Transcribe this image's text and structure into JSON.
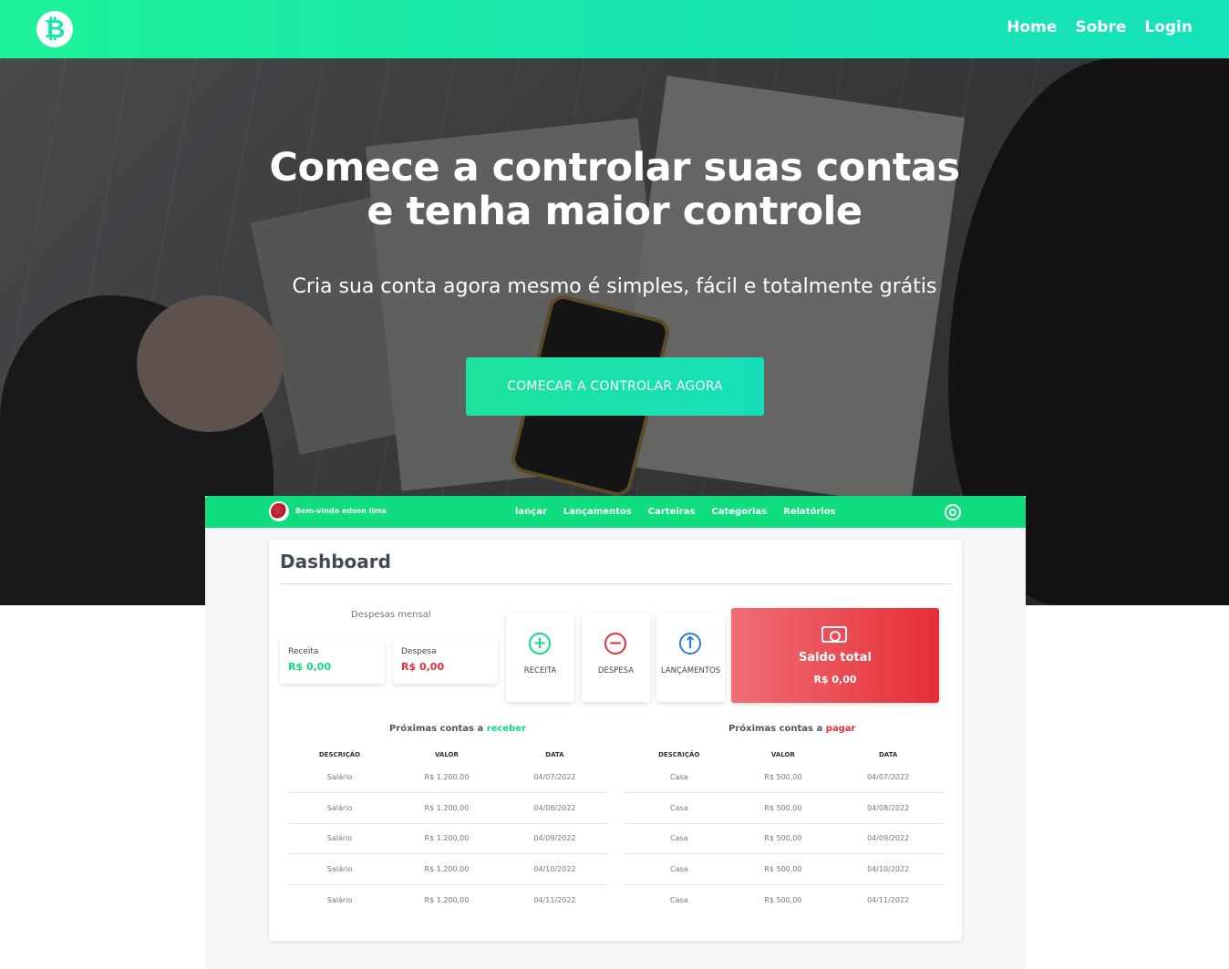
{
  "navbar": {
    "logo_glyph": "₿",
    "links": [
      "Home",
      "Sobre",
      "Login"
    ]
  },
  "hero": {
    "title_line1": "Comece a controlar suas contas",
    "title_line2": "e tenha maior controle",
    "subtitle": "Cria sua conta agora mesmo é simples, fácil e totalmente grátis",
    "cta_label": "COMECAR A CONTROLAR AGORA"
  },
  "preview": {
    "welcome": "Bem-vindo edson lima",
    "nav_links": [
      "lançar",
      "Lançamentos",
      "Carteiras",
      "Categorias",
      "Relatórios"
    ],
    "title": "Dashboard",
    "monthly_label": "Despesas mensal",
    "receita": {
      "label": "Receita",
      "value": "R$ 0,00"
    },
    "despesa": {
      "label": "Despesa",
      "value": "R$ 0,00"
    },
    "actions": [
      {
        "label": "RECEITA",
        "icon": "plus-circle-icon",
        "glyph": "+",
        "color": "#0fdd7e"
      },
      {
        "label": "DESPESA",
        "icon": "minus-circle-icon",
        "glyph": "−",
        "color": "#e62e36"
      },
      {
        "label": "LANÇAMENTOS",
        "icon": "arrow-up-circle-icon",
        "glyph": "↑",
        "color": "#2a7de1"
      }
    ],
    "saldo": {
      "label": "Saldo total",
      "value": "R$ 0,00",
      "icon": "money-icon"
    },
    "receber": {
      "heading_prefix": "Próximas contas a ",
      "heading_highlight": "receber",
      "columns": [
        "DESCRIÇÃO",
        "VALOR",
        "DATA"
      ],
      "rows": [
        [
          "Salário",
          "R$ 1.200,00",
          "04/07/2022"
        ],
        [
          "Salário",
          "R$ 1.200,00",
          "04/08/2022"
        ],
        [
          "Salário",
          "R$ 1.200,00",
          "04/09/2022"
        ],
        [
          "Salário",
          "R$ 1.200,00",
          "04/10/2022"
        ],
        [
          "Salário",
          "R$ 1.200,00",
          "04/11/2022"
        ]
      ]
    },
    "pagar": {
      "heading_prefix": "Próximas contas a ",
      "heading_highlight": "pagar",
      "columns": [
        "DESCRIÇÃO",
        "VALOR",
        "DATA"
      ],
      "rows": [
        [
          "Casa",
          "R$ 500,00",
          "04/07/2022"
        ],
        [
          "Casa",
          "R$ 500,00",
          "04/08/2022"
        ],
        [
          "Casa",
          "R$ 500,00",
          "04/09/2022"
        ],
        [
          "Casa",
          "R$ 500,00",
          "04/10/2022"
        ],
        [
          "Casa",
          "R$ 500,00",
          "04/11/2022"
        ]
      ]
    }
  }
}
